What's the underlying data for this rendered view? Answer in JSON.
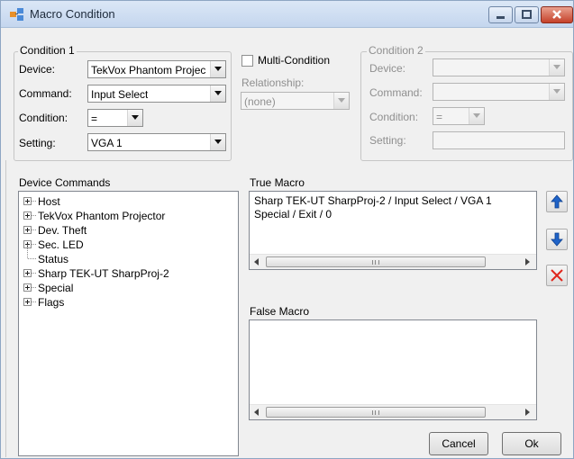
{
  "window": {
    "title": "Macro Condition"
  },
  "condition1": {
    "legend": "Condition 1",
    "device_label": "Device:",
    "device_value": "TekVox Phantom Projec",
    "command_label": "Command:",
    "command_value": "Input Select",
    "condition_label": "Condition:",
    "condition_value": "=",
    "setting_label": "Setting:",
    "setting_value": "VGA 1"
  },
  "middle": {
    "multi_condition_label": "Multi-Condition",
    "multi_condition_checked": false,
    "relationship_label": "Relationship:",
    "relationship_value": "(none)"
  },
  "condition2": {
    "legend": "Condition 2",
    "device_label": "Device:",
    "command_label": "Command:",
    "condition_label": "Condition:",
    "condition_value": "=",
    "setting_label": "Setting:"
  },
  "device_commands": {
    "label": "Device Commands",
    "items": [
      {
        "label": "Host",
        "expandable": true
      },
      {
        "label": "TekVox Phantom Projector",
        "expandable": true
      },
      {
        "label": "Dev. Theft",
        "expandable": true
      },
      {
        "label": "Sec. LED",
        "expandable": true
      },
      {
        "label": "Status",
        "expandable": false
      },
      {
        "label": "Sharp TEK-UT SharpProj-2",
        "expandable": true
      },
      {
        "label": "Special",
        "expandable": true
      },
      {
        "label": "Flags",
        "expandable": true
      }
    ]
  },
  "true_macro": {
    "label": "True Macro",
    "lines": [
      "Sharp TEK-UT SharpProj-2 / Input Select / VGA 1",
      "Special / Exit / 0"
    ]
  },
  "false_macro": {
    "label": "False Macro",
    "lines": []
  },
  "buttons": {
    "cancel": "Cancel",
    "ok": "Ok"
  },
  "colors": {
    "move_arrow": "#1f63c8",
    "delete_x": "#e0261c"
  }
}
